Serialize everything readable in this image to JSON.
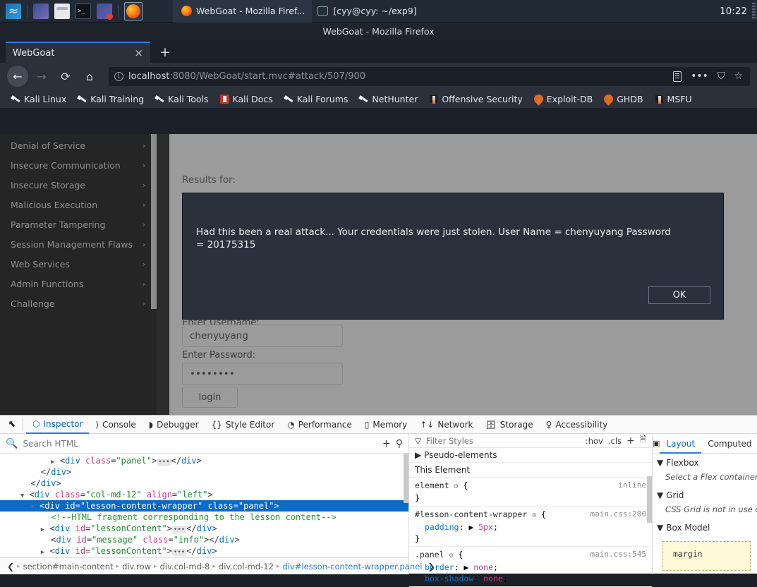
{
  "taskbar": {
    "launcher_icons": [
      "kali-dragon-icon",
      "app-purple-icon",
      "file-manager-icon",
      "terminal-icon",
      "remote-desktop-icon"
    ],
    "active_app_icon": "firefox-icon",
    "windows": [
      {
        "icon": "firefox-icon",
        "title": "WebGoat - Mozilla Firef..."
      },
      {
        "icon": "terminal-icon",
        "title": "[cyy@cyy: ~/exp9]"
      }
    ],
    "clock": "10:22"
  },
  "browser": {
    "window_title": "WebGoat - Mozilla Firefox",
    "tab": {
      "title": "WebGoat",
      "close_label": "×"
    },
    "new_tab_label": "+",
    "nav": {
      "back": "←",
      "forward": "→",
      "reload": "⟳",
      "home": "⌂"
    },
    "url": {
      "prefix": "localhost",
      "rest": ":8080/WebGoat/start.mvc#attack/507/900",
      "full": "localhost:8080/WebGoat/start.mvc#attack/507/900"
    },
    "url_icons": [
      "reader-mode-icon",
      "page-actions-icon",
      "pocket-icon",
      "bookmark-star-icon"
    ],
    "bookmarks": [
      {
        "label": "Kali Linux",
        "icon": "kali-dragon-icon"
      },
      {
        "label": "Kali Training",
        "icon": "kali-dragon-icon"
      },
      {
        "label": "Kali Tools",
        "icon": "kali-dragon-icon"
      },
      {
        "label": "Kali Docs",
        "icon": "kali-docs-icon"
      },
      {
        "label": "Kali Forums",
        "icon": "kali-dragon-icon"
      },
      {
        "label": "NetHunter",
        "icon": "kali-dragon-icon"
      },
      {
        "label": "Offensive Security",
        "icon": "offsec-tower-icon"
      },
      {
        "label": "Exploit-DB",
        "icon": "flame-icon"
      },
      {
        "label": "GHDB",
        "icon": "flame-icon"
      },
      {
        "label": "MSFU",
        "icon": "offsec-tower-icon"
      }
    ]
  },
  "webgoat": {
    "sidebar_items": [
      {
        "label": "Denial of Service"
      },
      {
        "label": "Insecure Communication"
      },
      {
        "label": "Insecure Storage"
      },
      {
        "label": "Malicious Execution"
      },
      {
        "label": "Parameter Tampering"
      },
      {
        "label": "Session Management Flaws"
      },
      {
        "label": "Web Services"
      },
      {
        "label": "Admin Functions"
      },
      {
        "label": "Challenge"
      }
    ],
    "chevron": "›",
    "results_label": "Results for:",
    "alert": {
      "message": "Had this been a real attack... Your credentials were just stolen. User Name = chenyuyang Password = 20175315",
      "ok_label": "OK"
    },
    "form": {
      "username_label": "Enter Username:",
      "username_value": "chenyuyang",
      "password_label": "Enter Password:",
      "password_value": "••••••••",
      "login_label": "login"
    }
  },
  "devtools": {
    "picker_icon": "element-picker-icon",
    "tabs": [
      {
        "label": "Inspector",
        "icon": "inspector-icon",
        "active": true
      },
      {
        "label": "Console",
        "icon": "console-icon",
        "active": false
      },
      {
        "label": "Debugger",
        "icon": "debugger-icon",
        "active": false
      },
      {
        "label": "Style Editor",
        "icon": "style-editor-icon",
        "active": false
      },
      {
        "label": "Performance",
        "icon": "performance-icon",
        "active": false
      },
      {
        "label": "Memory",
        "icon": "memory-icon",
        "active": false
      },
      {
        "label": "Network",
        "icon": "network-icon",
        "active": false
      },
      {
        "label": "Storage",
        "icon": "storage-icon",
        "active": false
      },
      {
        "label": "Accessibility",
        "icon": "accessibility-icon",
        "active": false
      }
    ],
    "markup": {
      "search_placeholder": "Search HTML",
      "add_node_label": "+",
      "eyedropper_label": "eyedropper-icon",
      "tree_lines": [
        {
          "indent": 5,
          "twisty": "▶",
          "html": "<span class=\"pun\">&lt;</span><span class=\"tag\">div</span> <span class=\"attr\">class</span><span class=\"pun\">=</span><span class=\"val\">\"panel\"</span><span class=\"pun\">&gt;</span><span class=\"ell\">•••</span><span class=\"pun\">&lt;/</span><span class=\"tag\">div</span><span class=\"pun\">&gt;</span>",
          "selected": false
        },
        {
          "indent": 4,
          "twisty": "",
          "html": "<span class=\"pun\">&lt;/</span><span class=\"tag\">div</span><span class=\"pun\">&gt;</span>",
          "selected": false
        },
        {
          "indent": 3,
          "twisty": "",
          "html": "<span class=\"pun\">&lt;/</span><span class=\"tag\">div</span><span class=\"pun\">&gt;</span>",
          "selected": false
        },
        {
          "indent": 2,
          "twisty": "▼",
          "html": "<span class=\"pun\">&lt;</span><span class=\"tag\">div</span> <span class=\"attr\">class</span><span class=\"pun\">=</span><span class=\"val\">\"col-md-12\"</span> <span class=\"attr\">align</span><span class=\"pun\">=</span><span class=\"val\">\"left\"</span><span class=\"pun\">&gt;</span>",
          "selected": false
        },
        {
          "indent": 3,
          "twisty": "▼",
          "html": "<span class=\"pun\">&lt;</span><span class=\"tag\">div</span> <span class=\"attr\">id</span><span class=\"pun\">=</span><span class=\"val\">\"lesson-content-wrapper\"</span> <span class=\"attr\">class</span><span class=\"pun\">=</span><span class=\"val\">\"panel\"</span><span class=\"pun\">&gt;</span>",
          "selected": true
        },
        {
          "indent": 5,
          "twisty": "",
          "html": "<span class=\"cmt\">&lt;!--HTML fragment corresponding to the lesson content--&gt;</span>",
          "selected": false
        },
        {
          "indent": 4,
          "twisty": "▶",
          "html": "<span class=\"pun\">&lt;</span><span class=\"tag\">div</span> <span class=\"attr\">id</span><span class=\"pun\">=</span><span class=\"val\">\"lessonContent\"</span><span class=\"pun\">&gt;</span><span class=\"ell\">•••</span><span class=\"pun\">&lt;/</span><span class=\"tag\">div</span><span class=\"pun\">&gt;</span>",
          "selected": false
        },
        {
          "indent": 5,
          "twisty": "",
          "html": "<span class=\"pun\">&lt;</span><span class=\"tag\">div</span> <span class=\"attr\">id</span><span class=\"pun\">=</span><span class=\"val\">\"message\"</span> <span class=\"attr\">class</span><span class=\"pun\">=</span><span class=\"val\">\"info\"</span><span class=\"pun\">&gt;&lt;/</span><span class=\"tag\">div</span><span class=\"pun\">&gt;</span>",
          "selected": false
        },
        {
          "indent": 4,
          "twisty": "▶",
          "html": "<span class=\"pun\">&lt;</span><span class=\"tag\">div</span> <span class=\"attr\">id</span><span class=\"pun\">=</span><span class=\"val\">\"lessonContent\"</span><span class=\"pun\">&gt;</span><span class=\"ell\">•••</span><span class=\"pun\">&lt;/</span><span class=\"tag\">div</span><span class=\"pun\">&gt;</span>",
          "selected": false
        }
      ],
      "breadcrumb": [
        "section#main-content",
        "div.row",
        "div.col-md-8",
        "div.col-md-12",
        "div#lesson-content-wrapper.panel"
      ],
      "breadcrumb_prev": "❮",
      "breadcrumb_next": "❯"
    },
    "styles": {
      "filter_placeholder": "Filter Styles",
      "hov_label": ":hov",
      "cls_label": ".cls",
      "add_rule_label": "+",
      "print_label": "print-icon",
      "pseudo_elements_label": "Pseudo-elements",
      "this_element_label": "This Element",
      "rules": [
        {
          "selector": "element",
          "source": "inline",
          "decls": []
        },
        {
          "selector": "#lesson-content-wrapper",
          "source": "main.css:200",
          "decls": [
            {
              "prop": "padding",
              "value": "5px"
            }
          ]
        },
        {
          "selector": ".panel",
          "source": "main.css:545",
          "decls": [
            {
              "prop": "border",
              "value": "none"
            },
            {
              "prop": "box-shadow",
              "value": "none"
            }
          ]
        }
      ]
    },
    "layout": {
      "expand_icon": "expand-pane-icon",
      "tabs": [
        {
          "label": "Layout",
          "active": true
        },
        {
          "label": "Computed",
          "active": false
        }
      ],
      "sections": [
        {
          "label": "Flexbox",
          "note": "Select a Flex container or item to continue."
        },
        {
          "label": "Grid",
          "note": "CSS Grid is not in use on this page"
        },
        {
          "label": "Box Model",
          "note": ""
        }
      ],
      "box_model_label": "margin",
      "collapse_caret": "▼"
    }
  }
}
